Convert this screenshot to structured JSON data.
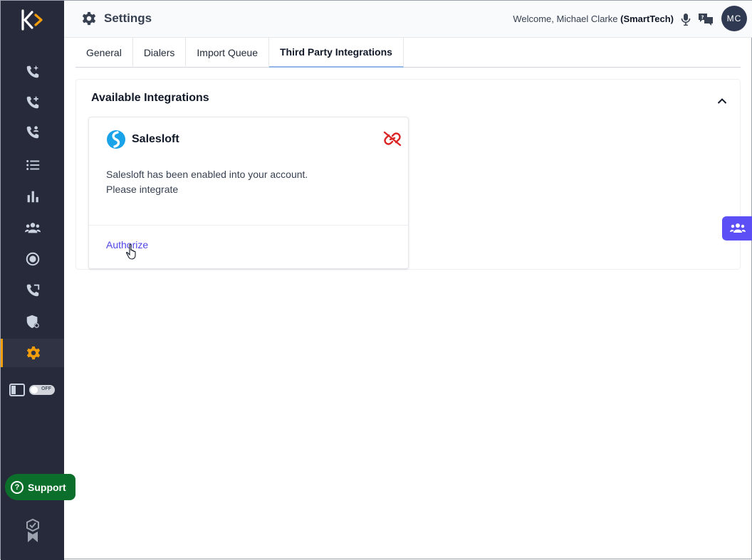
{
  "app": {
    "logo": "kixie-logo"
  },
  "header": {
    "title": "Settings",
    "welcome_prefix": "Welcome, Michael Clarke",
    "company": "(SmartTech)",
    "avatar_initials": "MC"
  },
  "sidebar": {
    "items": [
      {
        "icon": "phone-sparkle-icon"
      },
      {
        "icon": "phone-plus-icon"
      },
      {
        "icon": "phone-users-icon"
      },
      {
        "icon": "list-icon"
      },
      {
        "icon": "bar-chart-icon"
      },
      {
        "icon": "users-icon"
      },
      {
        "icon": "record-icon"
      },
      {
        "icon": "phone-transfer-icon"
      },
      {
        "icon": "shield-icon"
      },
      {
        "icon": "gear-icon",
        "active": true
      }
    ],
    "toggle_label": "OFF",
    "support_label": "Support"
  },
  "tabs": [
    {
      "label": "General"
    },
    {
      "label": "Dialers"
    },
    {
      "label": "Import Queue"
    },
    {
      "label": "Third Party Integrations",
      "active": true
    }
  ],
  "panel": {
    "title": "Available Integrations",
    "card": {
      "name": "Salesloft",
      "desc_line1": "Salesloft has been enabled into your account.",
      "desc_line2": "Please integrate",
      "action": "Authorize"
    }
  },
  "colors": {
    "sidebar_bg": "#272a3a",
    "active_accent": "#f59e0b",
    "link": "#4f46e5",
    "support_bg": "#0b6e2a",
    "unlink_red": "#dc2626",
    "float_btn": "#5b4ff5"
  }
}
